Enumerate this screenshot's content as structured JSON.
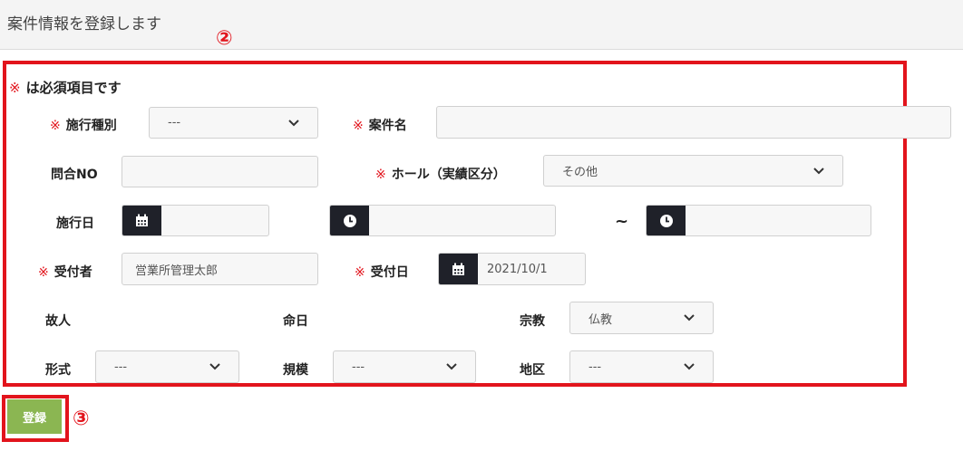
{
  "header": {
    "title": "案件情報を登録します"
  },
  "annotations": {
    "form_marker": "②",
    "button_marker": "③"
  },
  "form": {
    "required_note_mark": "※",
    "required_note": "は必須項目です",
    "required_mark": "※",
    "fields": {
      "construction_type": {
        "label": "施行種別",
        "value": "---"
      },
      "case_name": {
        "label": "案件名",
        "value": ""
      },
      "inquiry_no": {
        "label": "問合NO",
        "value": ""
      },
      "hall": {
        "label": "ホール（実績区分）",
        "value": "その他"
      },
      "construction_date": {
        "label": "施行日",
        "date": "",
        "time_start": "",
        "time_end": ""
      },
      "receiver": {
        "label": "受付者",
        "value": "営業所管理太郎"
      },
      "reception_date": {
        "label": "受付日",
        "value": "2021/10/1"
      },
      "deceased": {
        "label": "故人"
      },
      "death_date": {
        "label": "命日"
      },
      "religion": {
        "label": "宗教",
        "value": "仏教"
      },
      "format": {
        "label": "形式",
        "value": "---"
      },
      "scale": {
        "label": "規模",
        "value": "---"
      },
      "area": {
        "label": "地区",
        "value": "---"
      }
    },
    "range_separator": "~"
  },
  "actions": {
    "register_label": "登録"
  },
  "colors": {
    "accent_red": "#e2141c",
    "button_green": "#8bb652",
    "addon_dark": "#1f2129"
  },
  "icons": {
    "calendar": "calendar-icon",
    "clock": "clock-icon",
    "chevron": "chevron-down-icon"
  }
}
